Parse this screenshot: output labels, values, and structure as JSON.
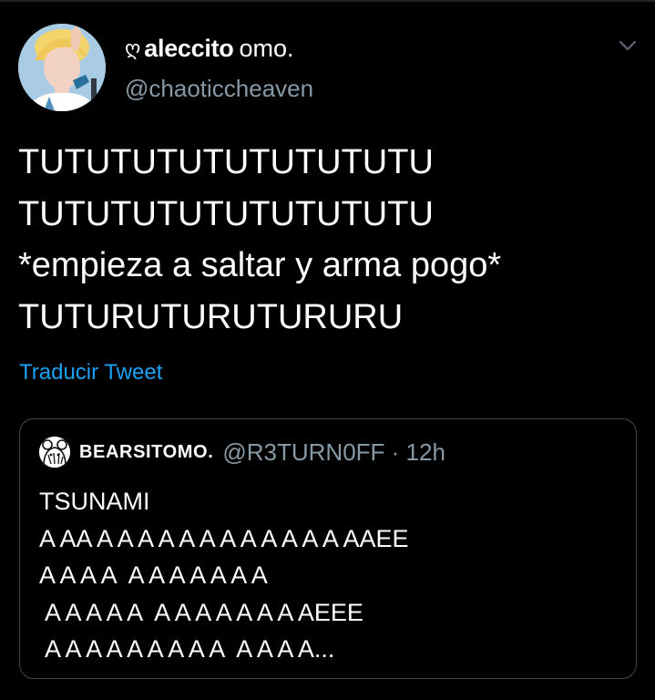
{
  "colors": {
    "background": "#000000",
    "secondary_text": "#8899a6",
    "link": "#1da1f2",
    "quote_border": "#3d4852"
  },
  "tweet": {
    "author": {
      "name_decoration": "ღ",
      "name_bold": "aleccito",
      "name_rest": "omo.",
      "handle": "@chaoticcheaven",
      "avatar_icon": "profile-photo"
    },
    "body_lines": [
      "TUTUTUTUTUTUTUTUTU",
      "TUTUTUTUTUTUTUTUTU",
      "*empieza a saltar y arma pogo*",
      "TUTURUTURUTURURU"
    ],
    "translate_link": "Traducir Tweet",
    "menu_icon": "chevron-down-icon"
  },
  "quoted_tweet": {
    "author_name": "BEARSITOMO.",
    "author_handle": "@R3TURN0FF · 12h",
    "avatar_icon": "bear-avatar",
    "body_lines": [
      "TSUNAMI",
      "A AA A A A A A A A A A A A A AAEE",
      "A A A A  A A A A A A A",
      " A A A A A  A A A A A A A AEEE",
      " A A A A A A A A A  A A A A..."
    ]
  }
}
